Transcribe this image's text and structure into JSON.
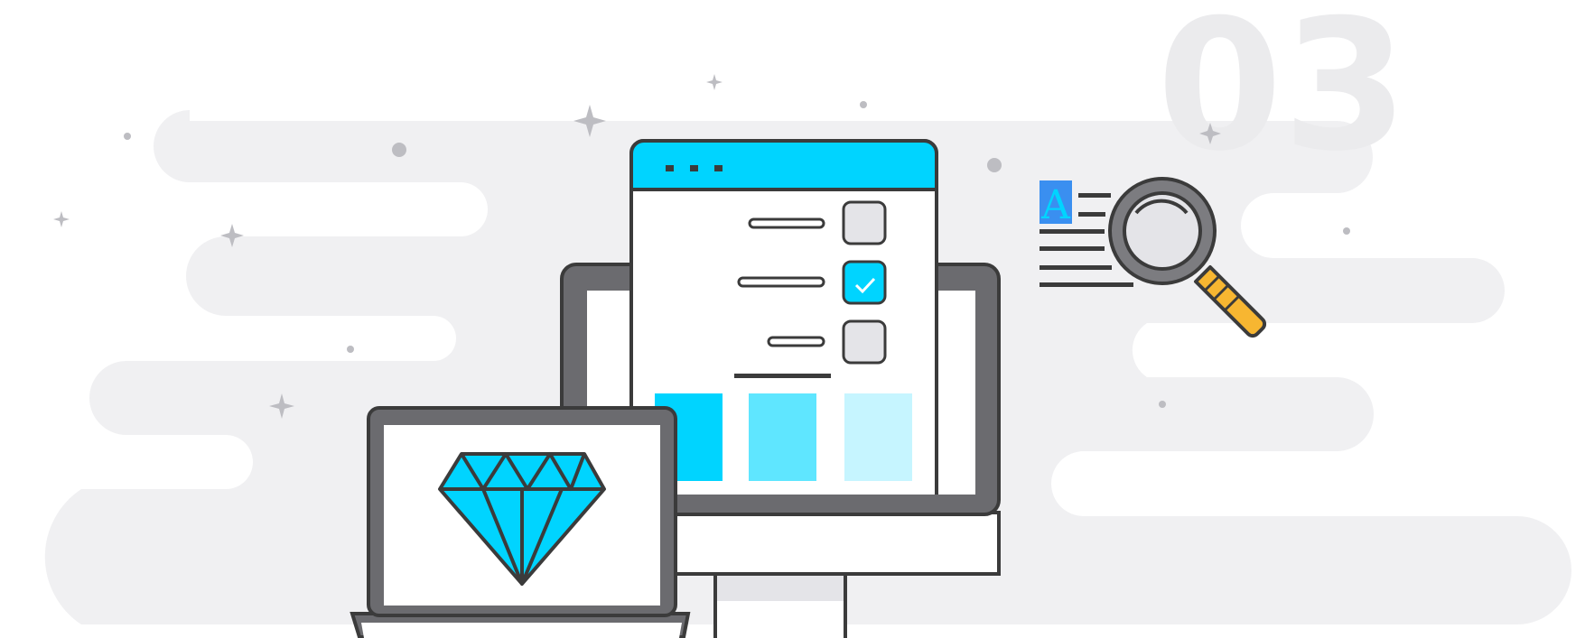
{
  "step_number": "03",
  "doc_letter": "A",
  "colors": {
    "cyan": "#00d4ff",
    "cyan_mid": "#5fe6ff",
    "cyan_light": "#c6f5ff",
    "outline": "#3b3b3b",
    "screen_gray": "#6b6b6f",
    "cloud": "#f0f0f2",
    "big_number": "#ebebed",
    "handle": "#f7b631",
    "doc_blue": "#3a8ff0",
    "checkbox_gray": "#e4e4e8",
    "sparkle": "#bdbdc2"
  },
  "icons": [
    "diamond-icon",
    "magnifier-icon",
    "document-icon",
    "checkmark-icon",
    "sparkle-icon"
  ]
}
